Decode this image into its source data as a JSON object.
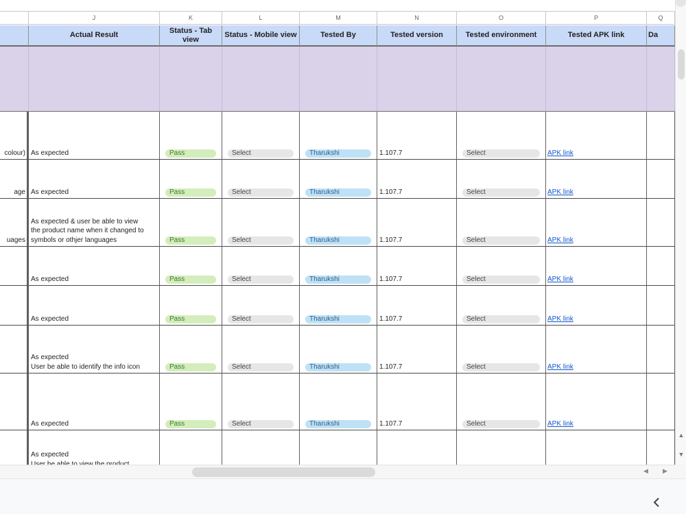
{
  "columns": {
    "letters": [
      "J",
      "K",
      "L",
      "M",
      "N",
      "O",
      "P",
      "Q"
    ],
    "headers": [
      "Actual Result",
      "Status - Tab view",
      "Status - Mobile view",
      "Tested By",
      "Tested version",
      "Tested environment",
      "Tested APK link",
      "Da"
    ]
  },
  "rows": [
    {
      "prev": "colour)",
      "actual": [
        "As expected"
      ],
      "status_tab": "Pass",
      "status_mobile": "Select",
      "tested_by": "Tharukshi",
      "version": "1.107.7",
      "environment": "Select",
      "apk": "APK link"
    },
    {
      "prev": "age",
      "actual": [
        "As expected"
      ],
      "status_tab": "Pass",
      "status_mobile": "Select",
      "tested_by": "Tharukshi",
      "version": "1.107.7",
      "environment": "Select",
      "apk": "APK link"
    },
    {
      "prev": "uages",
      "actual": [
        "As expected & user be able to view",
        "the product name when it changed to",
        "symbols or othjer languages"
      ],
      "status_tab": "Pass",
      "status_mobile": "Select",
      "tested_by": "Tharukshi",
      "version": "1.107.7",
      "environment": "Select",
      "apk": "APK link"
    },
    {
      "prev": "",
      "actual": [
        "As expected"
      ],
      "status_tab": "Pass",
      "status_mobile": "Select",
      "tested_by": "Tharukshi",
      "version": "1.107.7",
      "environment": "Select",
      "apk": "APK link"
    },
    {
      "prev": "",
      "actual": [
        "As expected"
      ],
      "status_tab": "Pass",
      "status_mobile": "Select",
      "tested_by": "Tharukshi",
      "version": "1.107.7",
      "environment": "Select",
      "apk": "APK link"
    },
    {
      "prev": "",
      "actual": [
        "As expected",
        "User be able to identify the info icon"
      ],
      "status_tab": "Pass",
      "status_mobile": "Select",
      "tested_by": "Tharukshi",
      "version": "1.107.7",
      "environment": "Select",
      "apk": "APK link"
    },
    {
      "prev": "",
      "actual": [
        "As expected"
      ],
      "status_tab": "Pass",
      "status_mobile": "Select",
      "tested_by": "Tharukshi",
      "version": "1.107.7",
      "environment": "Select",
      "apk": "APK link"
    },
    {
      "prev": "",
      "actual": [
        "As expected",
        "User be able to view the product"
      ],
      "status_tab": "",
      "status_mobile": "",
      "tested_by": "",
      "version": "",
      "environment": "",
      "apk": ""
    }
  ],
  "scroll": {
    "up_arrow": "▲",
    "down_arrow": "▼",
    "left_arrow": "◀",
    "right_arrow": "▶"
  },
  "footer": {
    "collapse_icon": "chevron-left-icon"
  },
  "colors": {
    "header_bg": "#c9daf8",
    "section_bg": "#d9d2e9",
    "pass_chip": "#d4edbc",
    "select_chip": "#e6e6e6",
    "person_chip": "#bfe1f6",
    "link": "#1155cc"
  }
}
